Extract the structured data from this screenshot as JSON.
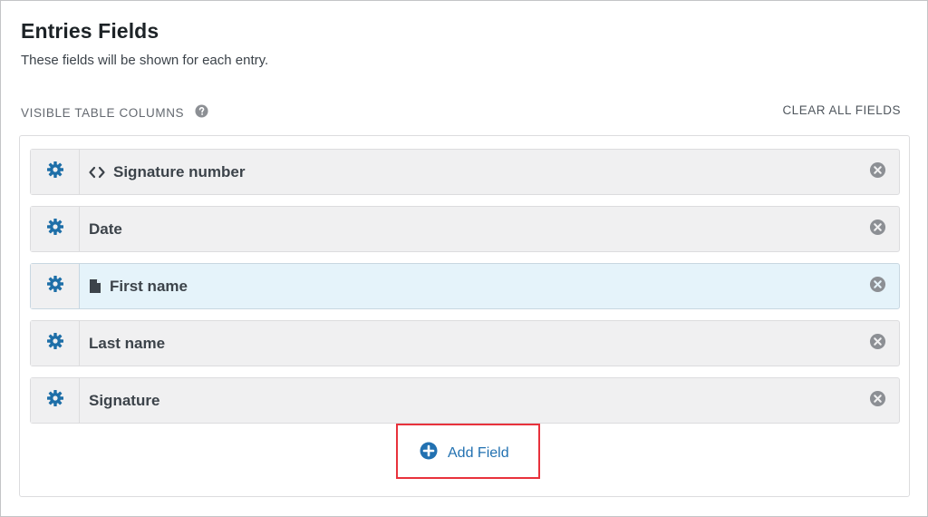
{
  "header": {
    "title": "Entries Fields",
    "subtitle": "These fields will be shown for each entry."
  },
  "section": {
    "label": "VISIBLE TABLE COLUMNS",
    "help_icon": "question-circle-icon",
    "clear_label": "CLEAR ALL FIELDS"
  },
  "fields": [
    {
      "label": "Signature number",
      "type_icon": "code-brackets-icon",
      "active": false
    },
    {
      "label": "Date",
      "type_icon": "",
      "active": false
    },
    {
      "label": "First name",
      "type_icon": "document-icon",
      "active": true
    },
    {
      "label": "Last name",
      "type_icon": "",
      "active": false
    },
    {
      "label": "Signature",
      "type_icon": "",
      "active": false
    }
  ],
  "add_field": {
    "label": "Add Field",
    "icon": "plus-circle-icon"
  },
  "colors": {
    "accent_blue": "#2271b1",
    "gear_blue": "#1e6fa8",
    "highlight_row": "#e5f3fa",
    "callout_red": "#e8323c",
    "remove_grey": "#8c8f94"
  }
}
